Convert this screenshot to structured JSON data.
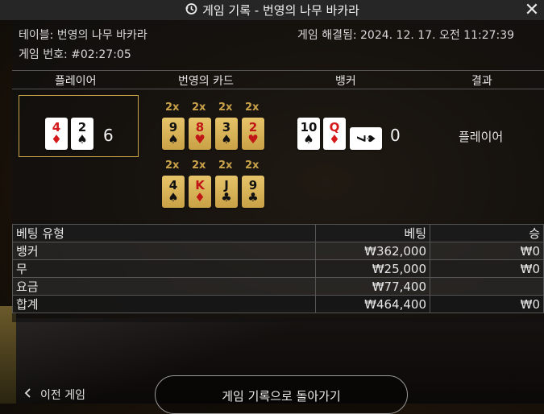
{
  "titlebar": {
    "title": "게임 기록 - 번영의 나무 바카라",
    "close_icon": "close-icon"
  },
  "info": {
    "table_label": "테이블: 번영의 나무 바카라",
    "resolved": "게임 해결됨: 2024. 12. 17. 오전 11:27:39",
    "game_number": "게임 번호: #02:27:05"
  },
  "columns": {
    "player": "플레이어",
    "prosperity_cards": "번영의 카드",
    "banker": "뱅커",
    "result": "결과"
  },
  "player": {
    "cards": [
      {
        "rank": "4",
        "suit": "♦",
        "color": "red"
      },
      {
        "rank": "2",
        "suit": "♠",
        "color": "blk"
      }
    ],
    "score": "6"
  },
  "prosperity": {
    "row1": [
      {
        "mult": "2x",
        "rank": "9",
        "suit": "♠",
        "color": "blk"
      },
      {
        "mult": "2x",
        "rank": "8",
        "suit": "♥",
        "color": "red"
      },
      {
        "mult": "2x",
        "rank": "3",
        "suit": "♠",
        "color": "blk"
      },
      {
        "mult": "2x",
        "rank": "2",
        "suit": "♥",
        "color": "red"
      }
    ],
    "row2": [
      {
        "mult": "2x",
        "rank": "4",
        "suit": "♠",
        "color": "blk"
      },
      {
        "mult": "2x",
        "rank": "K",
        "suit": "♦",
        "color": "red"
      },
      {
        "mult": "2x",
        "rank": "J",
        "suit": "♣",
        "color": "blk"
      },
      {
        "mult": "2x",
        "rank": "9",
        "suit": "♣",
        "color": "blk"
      }
    ]
  },
  "banker": {
    "cards": [
      {
        "rank": "10",
        "suit": "♠",
        "color": "blk"
      },
      {
        "rank": "Q",
        "suit": "♦",
        "color": "red"
      }
    ],
    "third_card": {
      "rank": "7",
      "suit": "♠",
      "color": "blk"
    },
    "score": "0"
  },
  "result": "플레이어",
  "bets": {
    "headers": {
      "type": "베팅 유형",
      "bet": "베팅",
      "win": "승"
    },
    "rows": [
      {
        "type": "뱅커",
        "bet": "₩362,000",
        "win": "₩0"
      },
      {
        "type": "무",
        "bet": "₩25,000",
        "win": "₩0"
      },
      {
        "type": "요금",
        "bet": "₩77,400",
        "win": ""
      }
    ],
    "total": {
      "type": "합계",
      "bet": "₩464,400",
      "win": "₩0"
    }
  },
  "footer": {
    "prev_label": "이전 게임",
    "back_label": "게임 기록으로 돌아가기"
  }
}
